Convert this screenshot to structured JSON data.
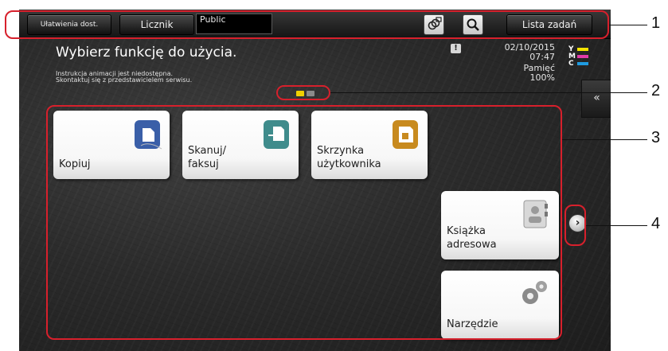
{
  "topbar": {
    "accessibility_label": "Ułatwienia dost.",
    "counter_label": "Licznik",
    "user_box_value": "Public",
    "task_list_label": "Lista zadań"
  },
  "main": {
    "title": "Wybierz funkcję do użycia.",
    "notice_line1": "Instrukcja animacji jest niedostępna.",
    "notice_line2": "Skontaktuj się z przedstawicielem serwisu."
  },
  "status": {
    "date": "02/10/2015",
    "time": "07:47",
    "memory_label": "Pamięć",
    "memory_value": "100%",
    "toner": [
      {
        "letter": "Y",
        "color": "#f4e400"
      },
      {
        "letter": "M",
        "color": "#e23aa8"
      },
      {
        "letter": "C",
        "color": "#1f9be0"
      }
    ]
  },
  "pager": {
    "active_color": "#f0d000",
    "inactive_color": "#8a8a8a"
  },
  "tiles": {
    "copy": "Kopiuj",
    "scan_fax": "Skanuj/\nfaksuj",
    "user_box": "Skrzynka\nużytkownika",
    "address_book": "Książka\nadresowa",
    "utility": "Narzędzie"
  },
  "icons": {
    "copy": "copy-icon",
    "scan": "scan-icon",
    "box": "user-box-icon",
    "address": "address-book-icon",
    "utility": "gears-icon"
  },
  "callouts": [
    "1",
    "2",
    "3",
    "4"
  ],
  "colors": {
    "callout": "#d7202c",
    "copy_icon": "#3a5fa8",
    "scan_icon": "#3f8c8c",
    "box_icon": "#c88a1e"
  }
}
